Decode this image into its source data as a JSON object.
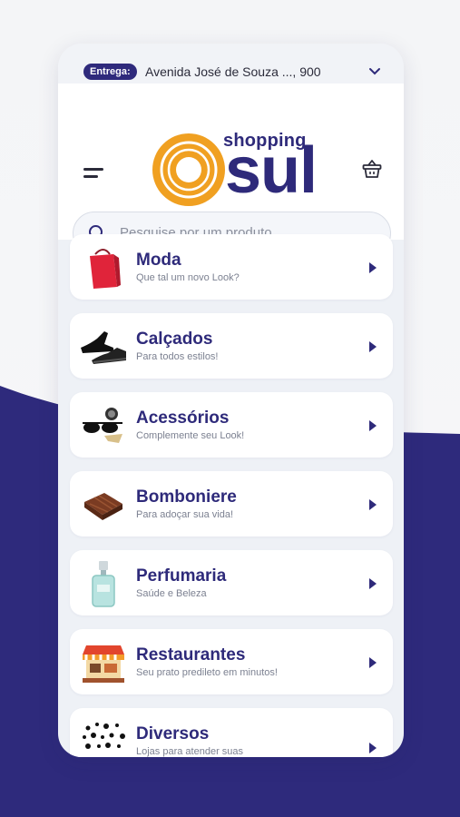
{
  "topbar": {
    "delivery_label": "Entrega:",
    "address": "Avenida José de Souza ..., 900"
  },
  "brand": {
    "shopping": "shopping",
    "sul": "sul",
    "primary_color": "#2e2a7a",
    "accent_color": "#f0a021"
  },
  "search": {
    "placeholder": "Pesquise por um produto"
  },
  "categories": [
    {
      "title": "Moda",
      "subtitle": "Que tal um novo Look?",
      "icon": "shopping-bag-icon"
    },
    {
      "title": "Calçados",
      "subtitle": "Para todos estilos!",
      "icon": "shoes-icon"
    },
    {
      "title": "Acessórios",
      "subtitle": "Complemente seu Look!",
      "icon": "sunglasses-watch-icon"
    },
    {
      "title": "Bomboniere",
      "subtitle": "Para adoçar sua vida!",
      "icon": "chocolate-icon"
    },
    {
      "title": "Perfumaria",
      "subtitle": "Saúde e Beleza",
      "icon": "perfume-icon"
    },
    {
      "title": "Restaurantes",
      "subtitle": "Seu prato predileto em minutos!",
      "icon": "restaurant-icon"
    },
    {
      "title": "Diversos",
      "subtitle": "Lojas para atender suas",
      "icon": "dots-icon"
    }
  ]
}
